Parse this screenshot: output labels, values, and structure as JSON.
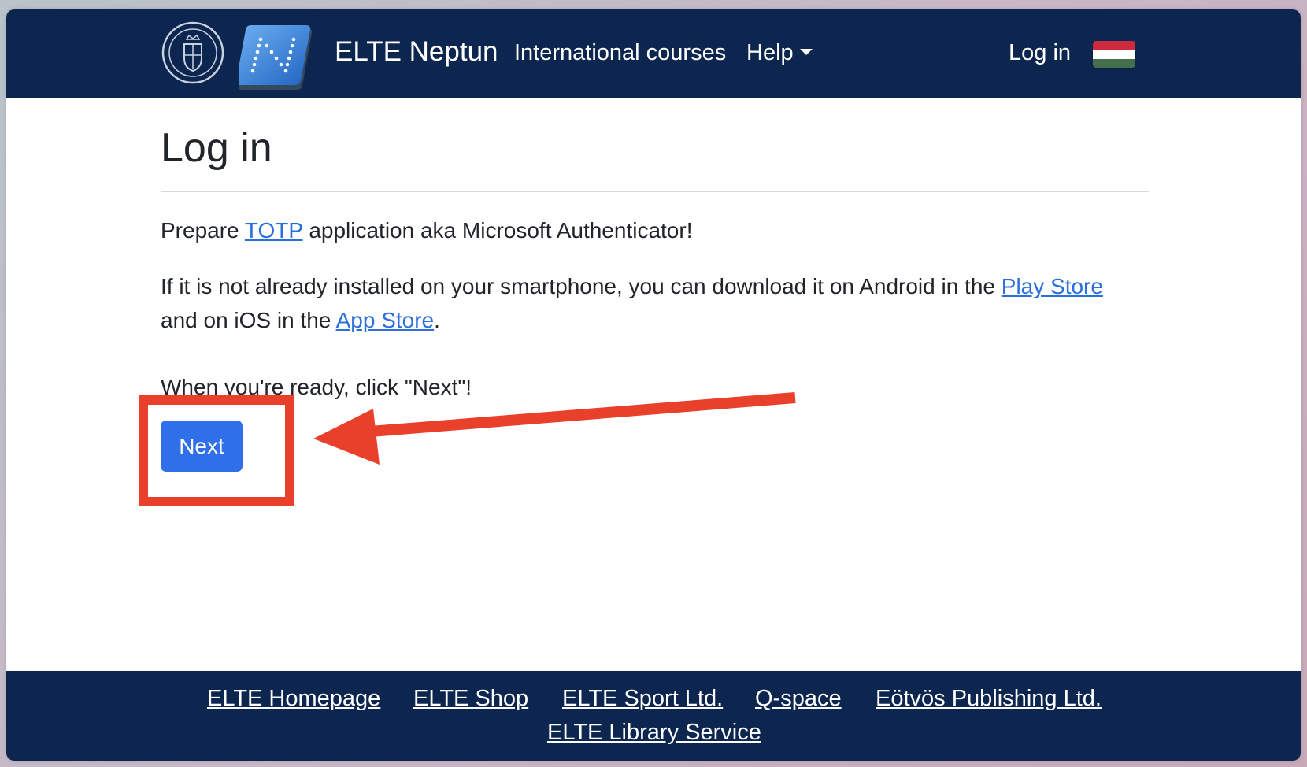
{
  "navbar": {
    "brand": "ELTE Neptun",
    "international_courses": "International courses",
    "help": "Help",
    "login": "Log in",
    "flag_colors": [
      "#cd2a3e",
      "#ffffff",
      "#436f4d"
    ],
    "bg_color": "#0d2650"
  },
  "main": {
    "title": "Log in",
    "p1_before": "Prepare ",
    "p1_link": "TOTP",
    "p1_after": " application aka Microsoft Authenticator!",
    "p2_before": "If it is not already installed on your smartphone, you can download it on Android in the ",
    "p2_link_play": "Play Store",
    "p2b_before": "and on iOS in the ",
    "p2b_link_app": "App Store",
    "p2b_after": ".",
    "p3": "When you're ready, click \"Next\"!",
    "next_button": "Next",
    "accent_color": "#2f6fea",
    "annotation_color": "#e8402a"
  },
  "footer": {
    "links": [
      "ELTE Homepage",
      "ELTE Shop",
      "ELTE Sport Ltd.",
      "Q-space",
      "Eötvös Publishing Ltd.",
      "ELTE Library Service"
    ]
  }
}
